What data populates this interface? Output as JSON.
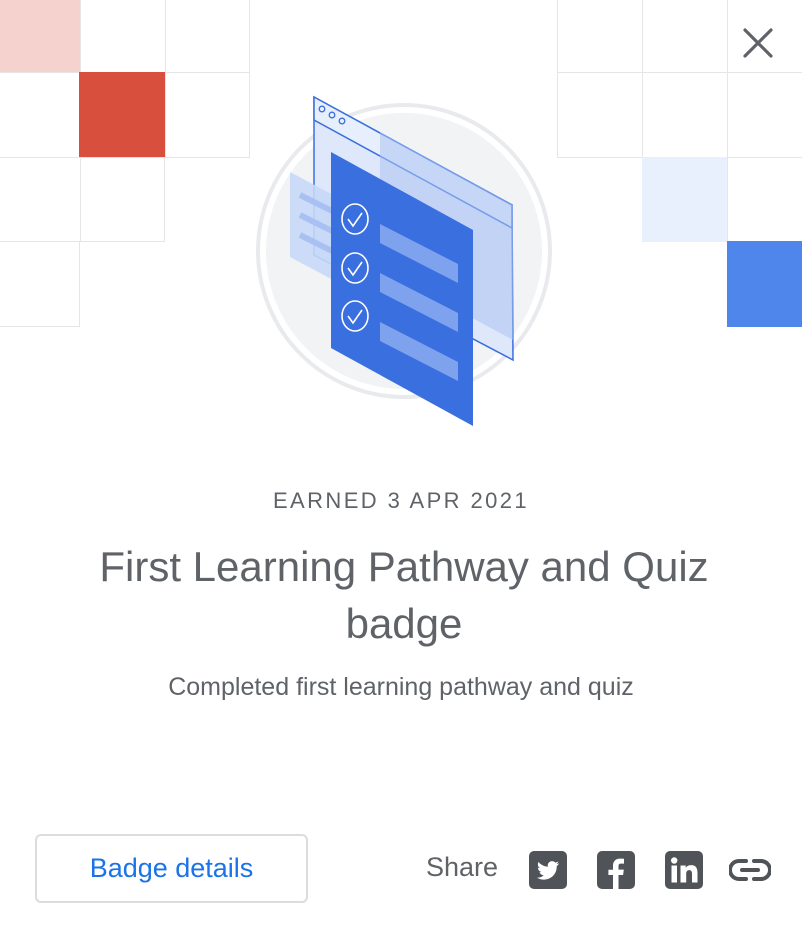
{
  "dialog": {
    "close_label": "Close",
    "earned_label": "EARNED 3 APR 2021",
    "title": "First Learning Pathway and Quiz badge",
    "description": "Completed first learning pathway and quiz",
    "badge_details_label": "Badge details",
    "share_label": "Share",
    "share_targets": [
      "twitter",
      "facebook",
      "linkedin",
      "copy-link"
    ]
  },
  "icons": {
    "close": "close-icon",
    "twitter": "twitter-icon",
    "facebook": "facebook-icon",
    "linkedin": "linkedin-icon",
    "link": "link-icon",
    "badge": "checklist-badge-icon"
  },
  "colors": {
    "accent_blue": "#1a73e8",
    "badge_blue": "#3a6fe0",
    "tile_red": "#d94f3d",
    "tile_pink": "#f6d2cf",
    "tile_light_blue": "#e8f0fd",
    "tile_blue": "#4f86ec",
    "text_gray": "#5f6368",
    "icon_dark": "#505357"
  }
}
